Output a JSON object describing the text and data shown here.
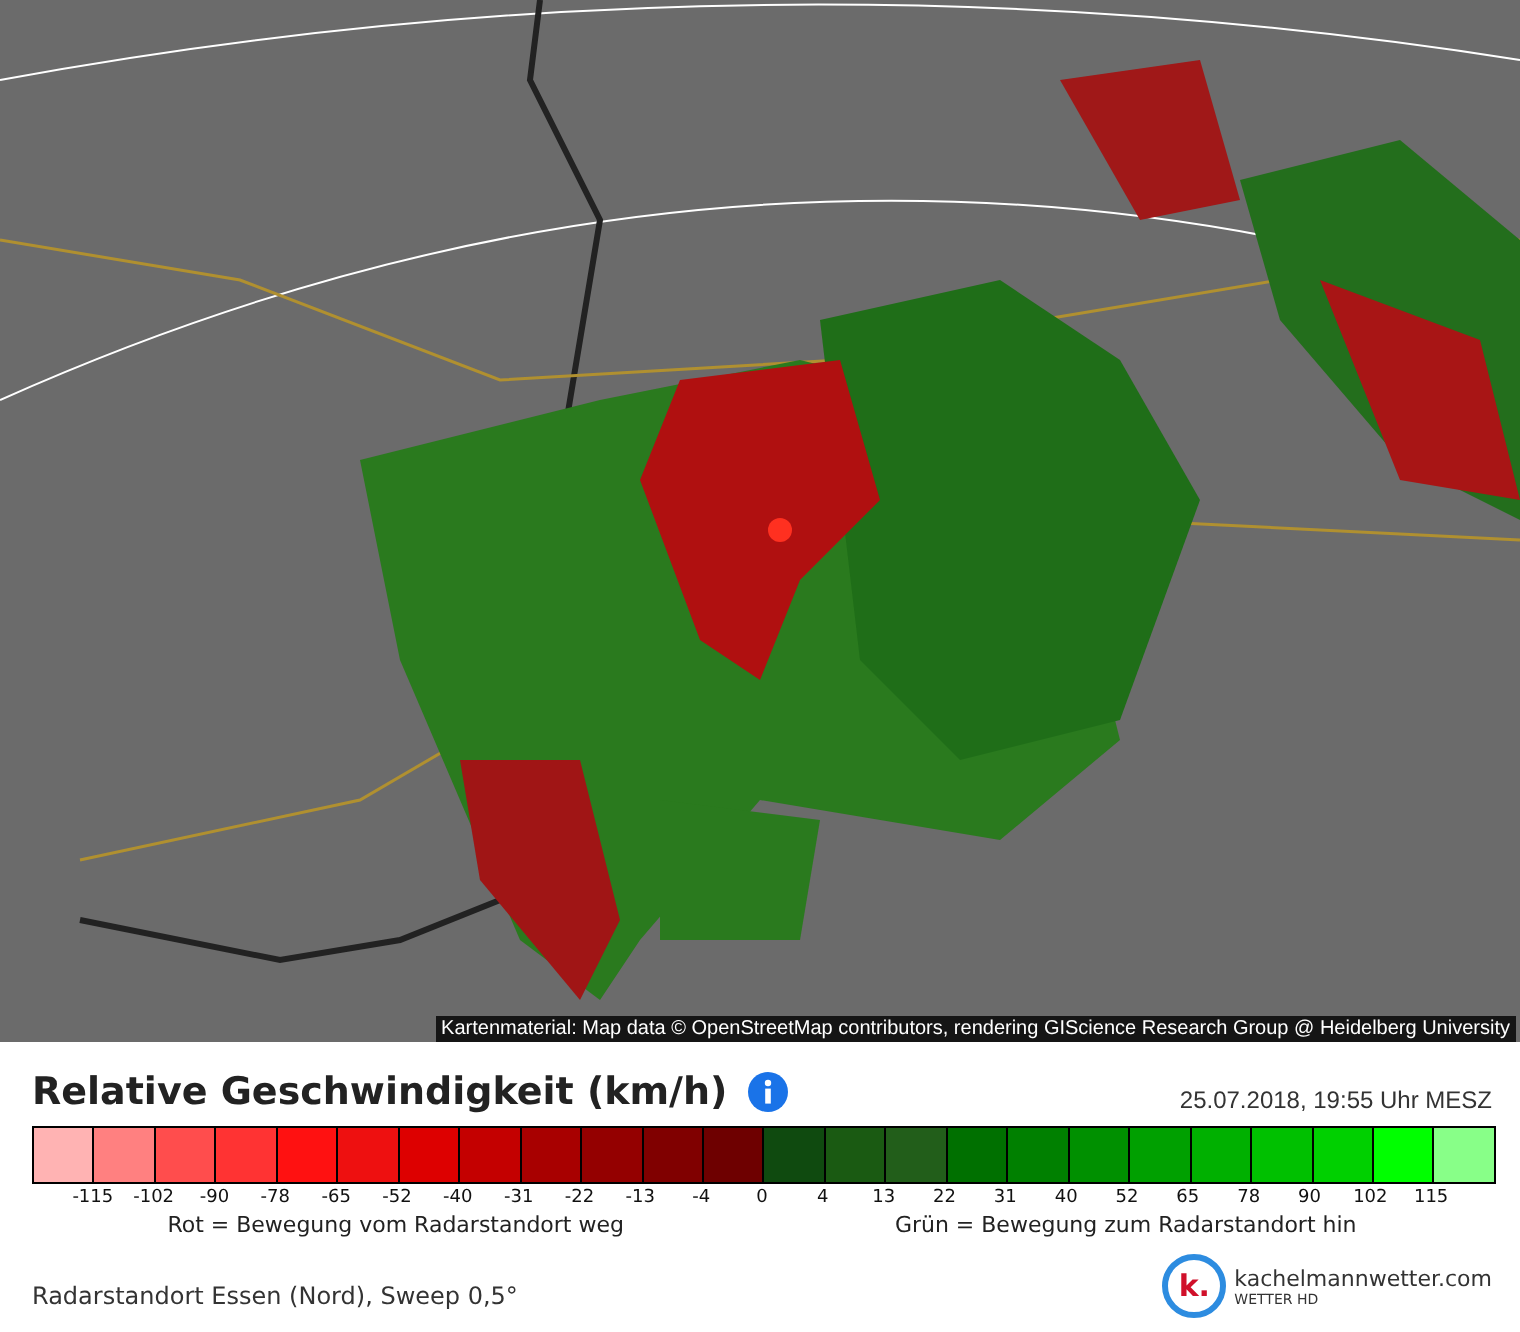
{
  "map": {
    "kind": "picture",
    "attribution": "Kartenmaterial: Map data © OpenStreetMap contributors, rendering GIScience Research Group @ Heidelberg University"
  },
  "legend": {
    "title": "Relative Geschwindigkeit (km/h)",
    "timestamp": "25.07.2018, 19:55 Uhr MESZ",
    "cells": [
      {
        "color": "#ffb3b3"
      },
      {
        "color": "#ff8080"
      },
      {
        "color": "#ff4d4d"
      },
      {
        "color": "#ff3333"
      },
      {
        "color": "#ff1111"
      },
      {
        "color": "#ee1010"
      },
      {
        "color": "#dd0000"
      },
      {
        "color": "#c40000"
      },
      {
        "color": "#a80000"
      },
      {
        "color": "#940000"
      },
      {
        "color": "#800000"
      },
      {
        "color": "#6e0000"
      },
      {
        "color": "#0f4a0f"
      },
      {
        "color": "#1a5a12"
      },
      {
        "color": "#225e1a"
      },
      {
        "color": "#007000"
      },
      {
        "color": "#008000"
      },
      {
        "color": "#009000"
      },
      {
        "color": "#00a000"
      },
      {
        "color": "#00b000"
      },
      {
        "color": "#00c000"
      },
      {
        "color": "#00d000"
      },
      {
        "color": "#00ff00"
      },
      {
        "color": "#88ff88"
      }
    ],
    "ticks": [
      "-115",
      "-102",
      "-90",
      "-78",
      "-65",
      "-52",
      "-40",
      "-31",
      "-22",
      "-13",
      "-4",
      "0",
      "4",
      "13",
      "22",
      "31",
      "40",
      "52",
      "65",
      "78",
      "90",
      "102",
      "115"
    ],
    "caption_left": "Rot = Bewegung vom Radarstandort weg",
    "caption_right": "Grün = Bewegung zum Radarstandort hin"
  },
  "footer": {
    "site": "Radarstandort Essen (Nord), Sweep 0,5°",
    "brand": "kachelmannwetter.com",
    "brand_sub": "WETTER HD",
    "brand_letter": "k."
  }
}
